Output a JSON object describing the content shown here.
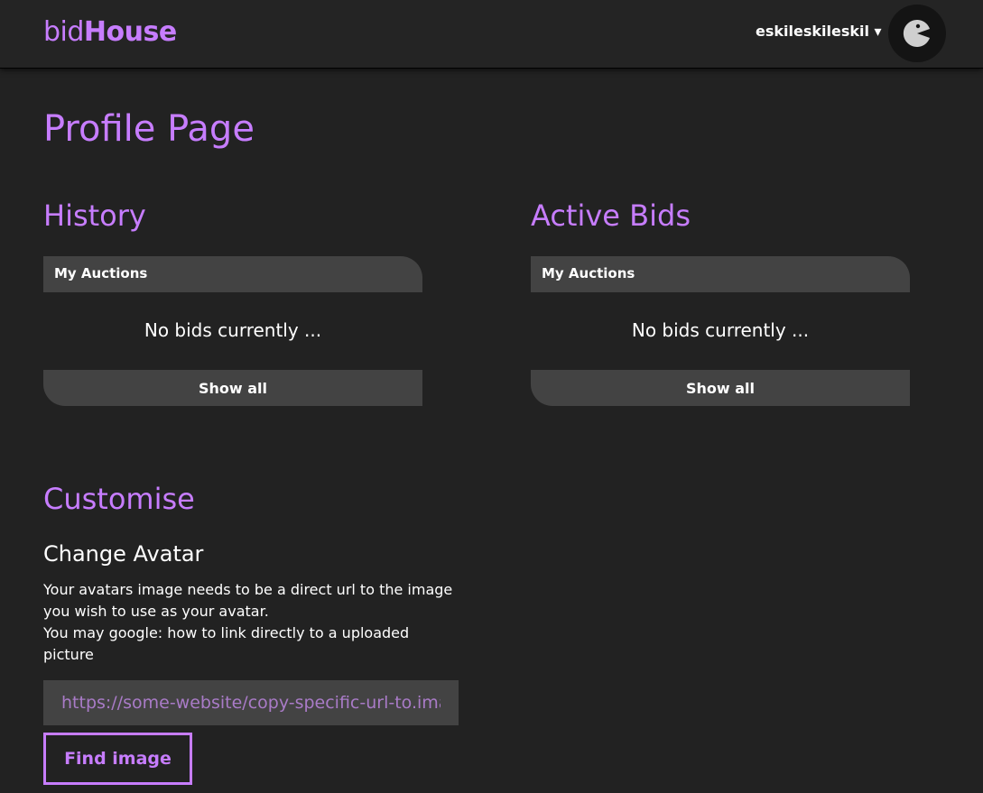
{
  "header": {
    "logo_light": "bid",
    "logo_bold": "House",
    "username": "eskileskileskil",
    "dropdown_arrow": "▾",
    "avatar_icon": "pacman-avatar-icon"
  },
  "page_title": "Profile Page",
  "history": {
    "title": "History",
    "panel_label": "My Auctions",
    "empty_text": "No bids currently ...",
    "show_all": "Show all"
  },
  "active_bids": {
    "title": "Active Bids",
    "panel_label": "My Auctions",
    "empty_text": "No bids currently ...",
    "show_all": "Show all"
  },
  "customise": {
    "title": "Customise",
    "subtitle": "Change Avatar",
    "desc_line1": "Your avatars image needs to be a direct url to the image you wish to use as your avatar.",
    "desc_line2": "You may google: how to link directly to a uploaded picture",
    "input_placeholder": "https://some-website/copy-specific-url-to.image",
    "find_button": "Find image"
  },
  "colors": {
    "accent": "#c77dff",
    "background": "#222222",
    "panel": "#434343"
  }
}
